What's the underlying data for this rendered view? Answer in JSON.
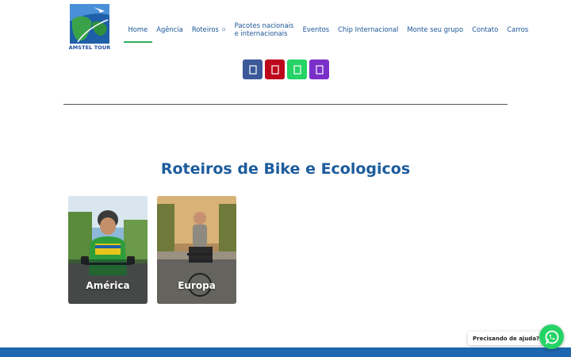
{
  "header": {
    "logo_text": "AMSTEL TOUR",
    "logo_icon": "globe-plane-logo",
    "nav": [
      {
        "label": "Home",
        "active": true
      },
      {
        "label": "Agência"
      },
      {
        "label": "Roteiros",
        "has_dropdown": true
      },
      {
        "label": "Pacotes nacionais e internacionais"
      },
      {
        "label": "Eventos"
      },
      {
        "label": "Chip Internacional"
      },
      {
        "label": "Monte seu grupo"
      },
      {
        "label": "Contato"
      },
      {
        "label": "Carros"
      }
    ],
    "accent_color": "#2fae5a"
  },
  "social": [
    {
      "name": "facebook",
      "icon": "facebook-icon",
      "color": "#3b5998"
    },
    {
      "name": "pinterest",
      "icon": "pinterest-icon",
      "color": "#bd081c"
    },
    {
      "name": "whatsapp",
      "icon": "whatsapp-icon",
      "color": "#25d366"
    },
    {
      "name": "viber",
      "icon": "viber-icon",
      "color": "#7b2fc9"
    }
  ],
  "main": {
    "title": "Roteiros de Bike e Ecologicos",
    "title_color": "#1c5c9c",
    "cards": [
      {
        "label": "América"
      },
      {
        "label": "Europa"
      }
    ]
  },
  "chat_widget": {
    "bubble_text": "Precisando de ajuda?",
    "icon": "whatsapp-icon"
  },
  "footer": {
    "color": "#1d66b0"
  }
}
